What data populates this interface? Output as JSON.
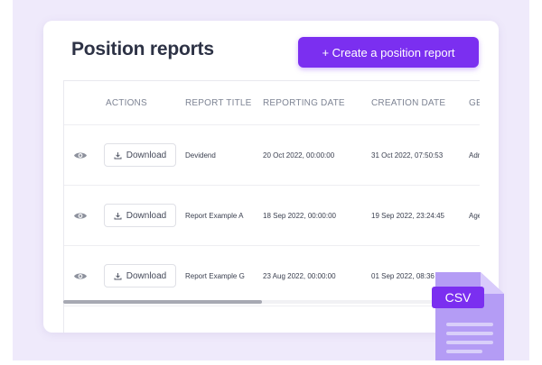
{
  "header": {
    "title": "Position reports",
    "create_button": "+ Create a position report"
  },
  "table": {
    "columns": [
      "",
      "ACTIONS",
      "REPORT TITLE",
      "REPORTING DATE",
      "CREATION DATE",
      "GE"
    ],
    "rows": [
      {
        "action": "Download",
        "title": "Devidend",
        "reporting_date": "20 Oct 2022, 00:00:00",
        "creation_date": "31 Oct 2022, 07:50:53",
        "ge": "Adm"
      },
      {
        "action": "Download",
        "title": "Report Example A",
        "reporting_date": "18 Sep 2022, 00:00:00",
        "creation_date": "19 Sep 2022, 23:24:45",
        "ge": "Age"
      },
      {
        "action": "Download",
        "title": "Report Example G",
        "reporting_date": "23 Aug 2022, 00:00:00",
        "creation_date": "01 Sep 2022, 08:36",
        "ge": ""
      }
    ]
  },
  "csv_badge": "CSV",
  "icons": {
    "view": "eye-icon",
    "download": "download-icon",
    "file": "csv-file-icon"
  },
  "colors": {
    "accent": "#7b2ff0",
    "background": "#efeafb",
    "file_icon": "#a98cf2"
  }
}
